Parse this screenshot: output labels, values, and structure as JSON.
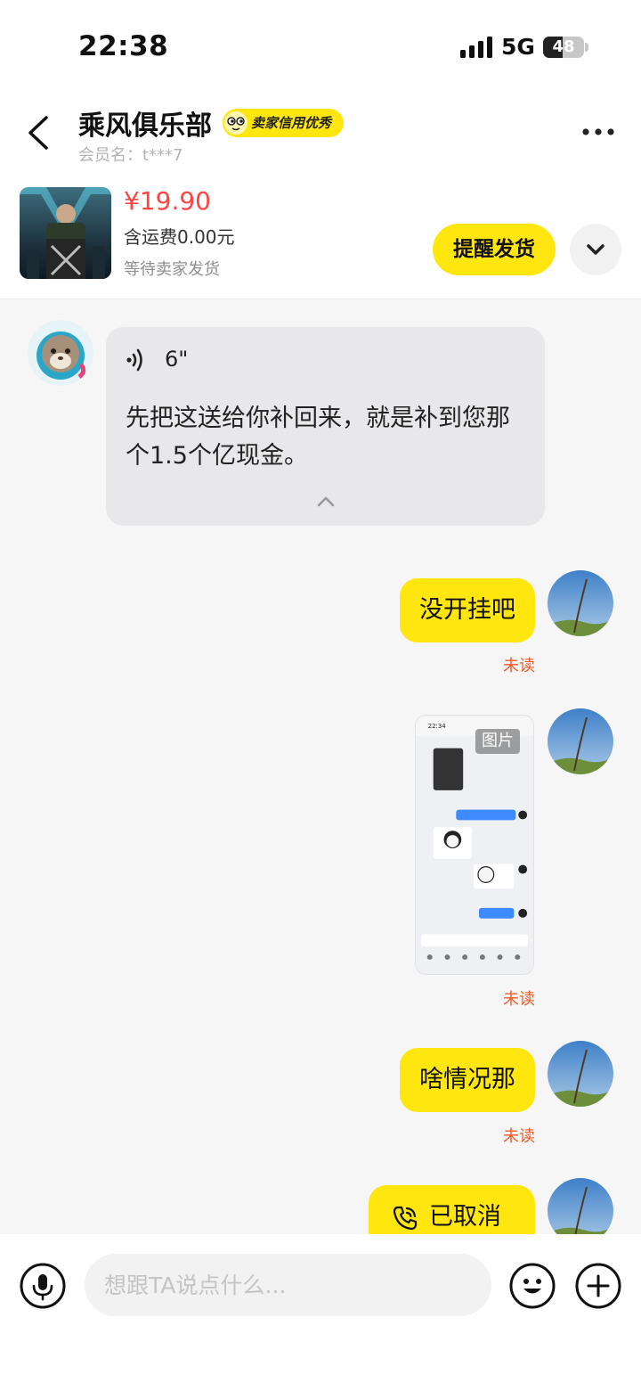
{
  "status_bar": {
    "time": "22:38",
    "network": "5G",
    "battery": "48",
    "battery_level": 0.48
  },
  "header": {
    "shop_name": "乘风俱乐部",
    "credit_badge": "卖家信用优秀",
    "member_label": "会员名：t***7",
    "back_icon": "chevron-left-icon",
    "more_icon": "more-dots-icon"
  },
  "order": {
    "price": "¥19.90",
    "shipping": "含运费0.00元",
    "status": "等待卖家发货",
    "remind_button": "提醒发货",
    "expand_icon": "chevron-down-icon"
  },
  "messages": [
    {
      "from": "seller",
      "type": "voice",
      "duration": "6\"",
      "transcript": "先把这送给你补回来，就是补到您那个1.5个亿现金。"
    },
    {
      "from": "me",
      "type": "text",
      "text": "没开挂吧",
      "read_status": "未读"
    },
    {
      "from": "me",
      "type": "image",
      "label": "图片",
      "read_status": "未读"
    },
    {
      "from": "me",
      "type": "text",
      "text": "啥情况那",
      "read_status": "未读"
    },
    {
      "from": "me",
      "type": "call",
      "text": "已取消"
    }
  ],
  "input_bar": {
    "placeholder": "想跟TA说点什么...",
    "mic_icon": "microphone-icon",
    "emoji_icon": "emoji-icon",
    "plus_icon": "plus-icon"
  },
  "colors": {
    "accent_yellow": "#ffe60f",
    "price_red": "#ff4444",
    "unread_orange": "#f05a28"
  }
}
